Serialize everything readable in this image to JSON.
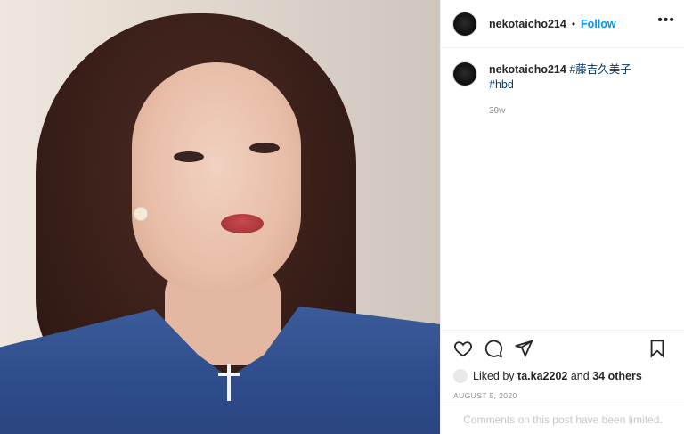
{
  "post": {
    "username": "nekotaicho214",
    "dot": "•",
    "follow_label": "Follow",
    "more_label": "•••",
    "caption_hashtag1": "#藤吉久美子",
    "caption_hashtag2": "#hbd",
    "time_ago": "39w",
    "likes_prefix": "Liked by",
    "likes_user": "ta.ka2202",
    "likes_mid": "and",
    "likes_others": "34 others",
    "date": "AUGUST 5, 2020",
    "comments_limited": "Comments on this post have been limited."
  },
  "icons": [
    "heart-icon",
    "comment-icon",
    "share-icon",
    "bookmark-icon",
    "more-icon"
  ],
  "colors": {
    "follow": "#0095f6",
    "hashtag": "#00376b",
    "muted": "#8e8e8e"
  }
}
